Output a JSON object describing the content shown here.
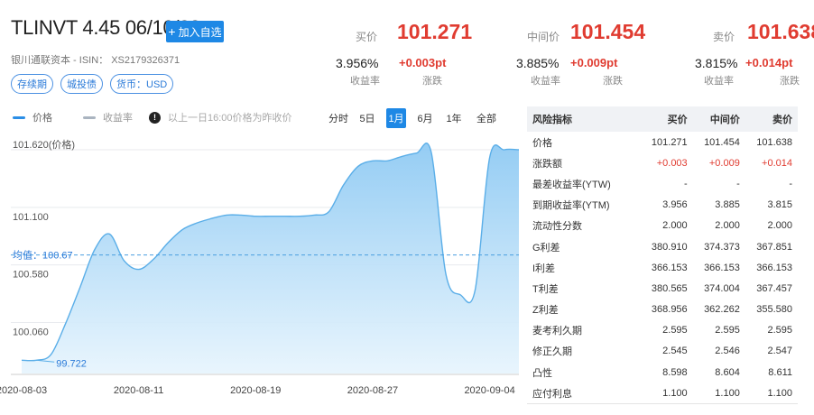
{
  "header": {
    "title": "TLINVT 4.45 06/10/23",
    "add_button": "加入自选",
    "issuer_line": "银川通联资本 - ISIN： XS2179326371",
    "tags": [
      "存续期",
      "城投债",
      "货币：USD"
    ]
  },
  "quotes": [
    {
      "label": "买价",
      "price": "101.271",
      "yield": "3.956%",
      "yield_label": "收益率",
      "change": "+0.003pt",
      "change_label": "涨跌"
    },
    {
      "label": "中间价",
      "price": "101.454",
      "yield": "3.885%",
      "yield_label": "收益率",
      "change": "+0.009pt",
      "change_label": "涨跌"
    },
    {
      "label": "卖价",
      "price": "101.638",
      "yield": "3.815%",
      "yield_label": "收益率",
      "change": "+0.014pt",
      "change_label": "涨跌"
    }
  ],
  "legend": {
    "price": "价格",
    "yield": "收益率",
    "note": "以上一日16:00价格为昨收价"
  },
  "periods": [
    "分时",
    "5日",
    "1月",
    "6月",
    "1年",
    "全部"
  ],
  "active_period": "1月",
  "colors": {
    "accent": "#1e88e5",
    "up": "#e03c31",
    "line": "#5aaee8"
  },
  "chart_data": {
    "type": "area",
    "ylabel_top": "101.620(价格)",
    "yticks": [
      "101.100",
      "100.580",
      "100.060"
    ],
    "ylim": [
      99.6,
      101.62
    ],
    "avg_label": "均值：100.67",
    "avg": 100.67,
    "min_label": "99.722",
    "xticks": [
      "2020-08-03",
      "2020-08-11",
      "2020-08-19",
      "2020-08-27",
      "2020-09-04"
    ],
    "x": [
      0,
      1,
      2,
      3,
      4,
      5,
      6,
      7,
      8,
      9,
      10,
      11,
      12,
      13,
      14,
      15,
      16,
      17,
      18,
      19,
      20,
      21,
      22,
      23,
      24,
      25,
      26,
      27,
      28,
      29,
      30,
      31,
      32,
      33,
      34
    ],
    "values": [
      99.72,
      99.72,
      99.77,
      100.05,
      100.38,
      100.72,
      100.86,
      100.62,
      100.54,
      100.63,
      100.78,
      100.9,
      100.96,
      101.0,
      101.03,
      101.03,
      101.02,
      101.02,
      101.02,
      101.02,
      101.03,
      101.06,
      101.3,
      101.47,
      101.52,
      101.52,
      101.56,
      101.59,
      101.6,
      100.5,
      100.31,
      100.35,
      101.55,
      101.62,
      101.62
    ]
  },
  "risk_table": {
    "headers": [
      "风险指标",
      "买价",
      "中间价",
      "卖价"
    ],
    "rows": [
      [
        "价格",
        "101.271",
        "101.454",
        "101.638"
      ],
      [
        "涨跌额",
        "+0.003",
        "+0.009",
        "+0.014"
      ],
      [
        "最差收益率(YTW)",
        "-",
        "-",
        "-"
      ],
      [
        "到期收益率(YTM)",
        "3.956",
        "3.885",
        "3.815"
      ],
      [
        "流动性分数",
        "2.000",
        "2.000",
        "2.000"
      ],
      [
        "G利差",
        "380.910",
        "374.373",
        "367.851"
      ],
      [
        "I利差",
        "366.153",
        "366.153",
        "366.153"
      ],
      [
        "T利差",
        "380.565",
        "374.004",
        "367.457"
      ],
      [
        "Z利差",
        "368.956",
        "362.262",
        "355.580"
      ],
      [
        "麦考利久期",
        "2.595",
        "2.595",
        "2.595"
      ],
      [
        "修正久期",
        "2.545",
        "2.546",
        "2.547"
      ],
      [
        "凸性",
        "8.598",
        "8.604",
        "8.611"
      ],
      [
        "应付利息",
        "1.100",
        "1.100",
        "1.100"
      ]
    ]
  }
}
